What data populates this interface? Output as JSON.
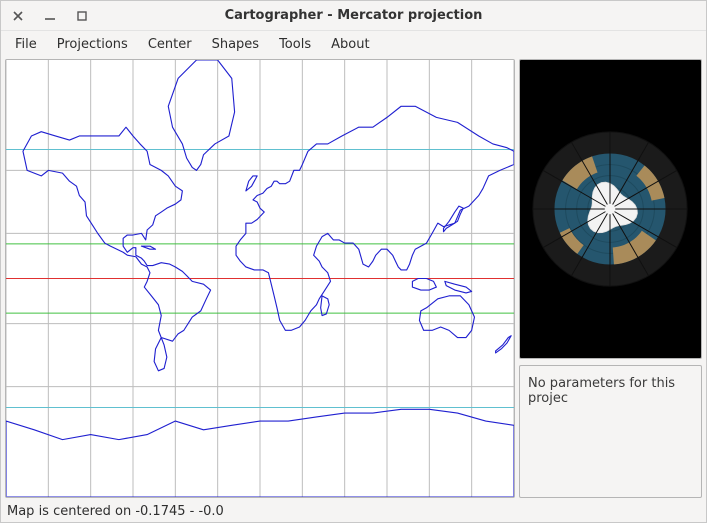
{
  "window": {
    "title": "Cartographer - Mercator projection"
  },
  "menubar": {
    "items": [
      "File",
      "Projections",
      "Center",
      "Shapes",
      "Tools",
      "About"
    ]
  },
  "map": {
    "graticule_spacing_deg": 30,
    "tropics_deg": 23.5,
    "polar_circle_deg": 66.5,
    "equator_color": "#e03030",
    "tropic_color": "#40c040",
    "polar_color": "#60c0d0",
    "grid_color": "#bdbdbd",
    "coast_color": "#2020d0"
  },
  "side": {
    "params_text": "No parameters for this projec"
  },
  "status": {
    "text": "Map is centered on -0.1745  -  -0.0"
  },
  "chart_data": {
    "type": "map",
    "projection": "Mercator",
    "center_lon": -0.1745,
    "center_lat": -0.0,
    "overlays": [
      "graticule-30deg",
      "equator",
      "tropics",
      "polar-circles",
      "coastlines"
    ],
    "preview_projection": "azimuthal-south-pole"
  }
}
